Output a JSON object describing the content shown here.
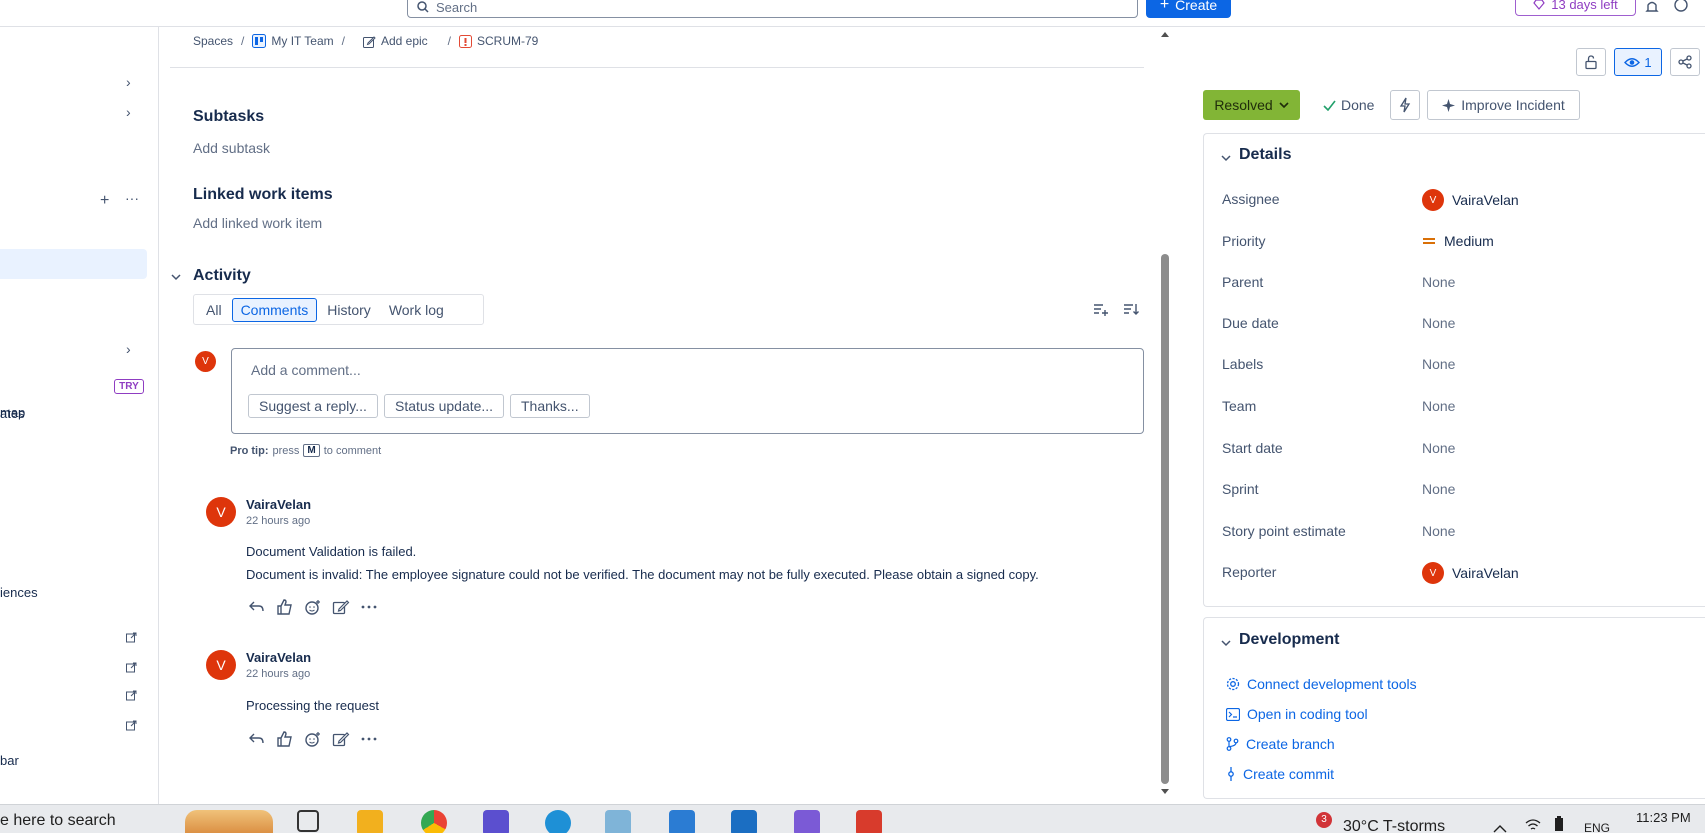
{
  "topbar": {
    "search_placeholder": "Search",
    "create_label": "Create",
    "trial_label": "13 days left"
  },
  "sidebar": {
    "item_map": "map",
    "item_ates": "ates",
    "item_iences": "iences",
    "item_bar": "bar",
    "try_badge": "TRY"
  },
  "breadcrumb": {
    "spaces": "Spaces",
    "project": "My IT Team",
    "epic": "Add epic",
    "issue": "SCRUM-79",
    "sep": "/"
  },
  "subtasks": {
    "title": "Subtasks",
    "add": "Add subtask"
  },
  "linked": {
    "title": "Linked work items",
    "add": "Add linked work item"
  },
  "activity": {
    "title": "Activity",
    "tabs": [
      "All",
      "Comments",
      "History",
      "Work log"
    ],
    "active_tab": "Comments",
    "comment_placeholder": "Add a comment...",
    "avatar_letter": "V",
    "chips": [
      "Suggest a reply...",
      "Status update...",
      "Thanks..."
    ],
    "protip": {
      "bold": "Pro tip:",
      "pre": "press",
      "key": "M",
      "post": "to comment"
    }
  },
  "comments": [
    {
      "author": "VairaVelan",
      "time": "22 hours ago",
      "avatar": "V",
      "lines": [
        "Document Validation is failed.",
        "Document is invalid: The employee signature could not be verified. The document may not be fully executed. Please obtain a signed copy."
      ]
    },
    {
      "author": "VairaVelan",
      "time": "22 hours ago",
      "avatar": "V",
      "lines": [
        "Processing the request"
      ]
    }
  ],
  "right_panel": {
    "watch_count": "1",
    "status": "Resolved",
    "done": "Done",
    "improve": "Improve Incident",
    "details": {
      "title": "Details",
      "fields": [
        {
          "label": "Assignee",
          "value": "VairaVelan",
          "type": "user"
        },
        {
          "label": "Priority",
          "value": "Medium",
          "type": "priority"
        },
        {
          "label": "Parent",
          "value": "None"
        },
        {
          "label": "Due date",
          "value": "None"
        },
        {
          "label": "Labels",
          "value": "None"
        },
        {
          "label": "Team",
          "value": "None"
        },
        {
          "label": "Start date",
          "value": "None"
        },
        {
          "label": "Sprint",
          "value": "None"
        },
        {
          "label": "Story point estimate",
          "value": "None"
        },
        {
          "label": "Reporter",
          "value": "VairaVelan",
          "type": "user"
        }
      ]
    },
    "development": {
      "title": "Development",
      "links": [
        "Connect development tools",
        "Open in coding tool",
        "Create branch",
        "Create commit"
      ]
    }
  },
  "taskbar": {
    "search_text": "e here to search",
    "weather": "30°C  T-storms",
    "lang": "ENG",
    "time": "11:23 PM",
    "badge_count": "3"
  },
  "colors": {
    "accent": "#0c66e4",
    "status_resolved": "#82b536",
    "avatar": "#de350b",
    "trial": "#8f3dc2"
  }
}
